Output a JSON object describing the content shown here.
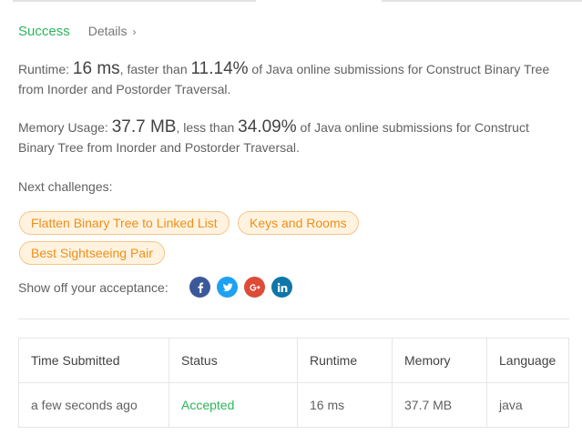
{
  "header": {
    "status": "Success",
    "details_label": "Details",
    "details_chevron": "›"
  },
  "runtime": {
    "label": "Runtime: ",
    "value": "16 ms",
    "faster_prefix": ", faster than ",
    "percent": "11.14%",
    "suffix": " of Java online submissions for Construct Binary Tree from Inorder and Postorder Traversal."
  },
  "memory": {
    "label": "Memory Usage: ",
    "value": "37.7 MB",
    "less_prefix": ", less than ",
    "percent": "34.09%",
    "suffix": " of Java online submissions for Construct Binary Tree from Inorder and Postorder Traversal."
  },
  "next_challenges": {
    "label": "Next challenges:",
    "items": [
      "Flatten Binary Tree to Linked List",
      "Keys and Rooms",
      "Best Sightseeing Pair"
    ]
  },
  "share": {
    "label": "Show off your acceptance:",
    "icons": [
      "facebook-icon",
      "twitter-icon",
      "google-plus-icon",
      "linkedin-icon"
    ]
  },
  "table": {
    "headers": [
      "Time Submitted",
      "Status",
      "Runtime",
      "Memory",
      "Language"
    ],
    "rows": [
      {
        "time": "a few seconds ago",
        "status": "Accepted",
        "runtime": "16 ms",
        "memory": "37.7 MB",
        "language": "java"
      }
    ]
  },
  "colors": {
    "success": "#2db55d",
    "pill_border": "#f5c48b",
    "pill_bg": "#fff3e0",
    "pill_text": "#ef8f1a",
    "facebook": "#3b5998",
    "twitter": "#1da1f2",
    "google_plus": "#dd4b39",
    "linkedin": "#0e76a8"
  }
}
